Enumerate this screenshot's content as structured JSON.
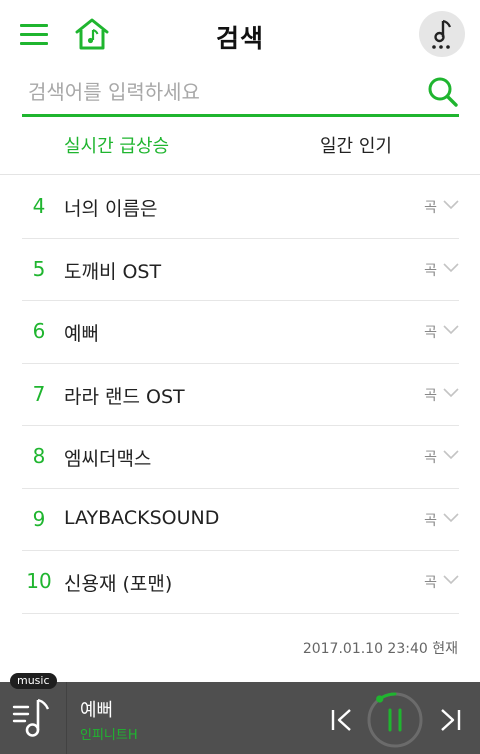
{
  "header": {
    "title": "검색",
    "menu_icon": "hamburger-menu-icon",
    "home_icon": "home-music-icon",
    "music_icon": "music-note-more-icon"
  },
  "search": {
    "placeholder": "검색어를 입력하세요",
    "value": "",
    "icon": "search-icon"
  },
  "tabs": [
    {
      "label": "실시간 급상승",
      "active": true
    },
    {
      "label": "일간 인기",
      "active": false
    }
  ],
  "ranking": [
    {
      "rank": "4",
      "title": "너의 이름은",
      "type": "곡"
    },
    {
      "rank": "5",
      "title": "도깨비 OST",
      "type": "곡"
    },
    {
      "rank": "6",
      "title": "예뻐",
      "type": "곡"
    },
    {
      "rank": "7",
      "title": "라라 랜드 OST",
      "type": "곡"
    },
    {
      "rank": "8",
      "title": "엠씨더맥스",
      "type": "곡"
    },
    {
      "rank": "9",
      "title": "LAYBACKSOUND",
      "type": "곡"
    },
    {
      "rank": "10",
      "title": "신용재 (포맨)",
      "type": "곡"
    }
  ],
  "timestamp": "2017.01.10 23:40 현재",
  "player": {
    "badge": "music",
    "track_title": "예뻐",
    "track_artist": "인피니트H",
    "state": "playing",
    "progress": 0.1
  },
  "colors": {
    "accent": "#1fb52f",
    "player_bg": "#4f4f4f",
    "badge_bg": "#1f1f1f",
    "divider": "#e6e6e6"
  }
}
